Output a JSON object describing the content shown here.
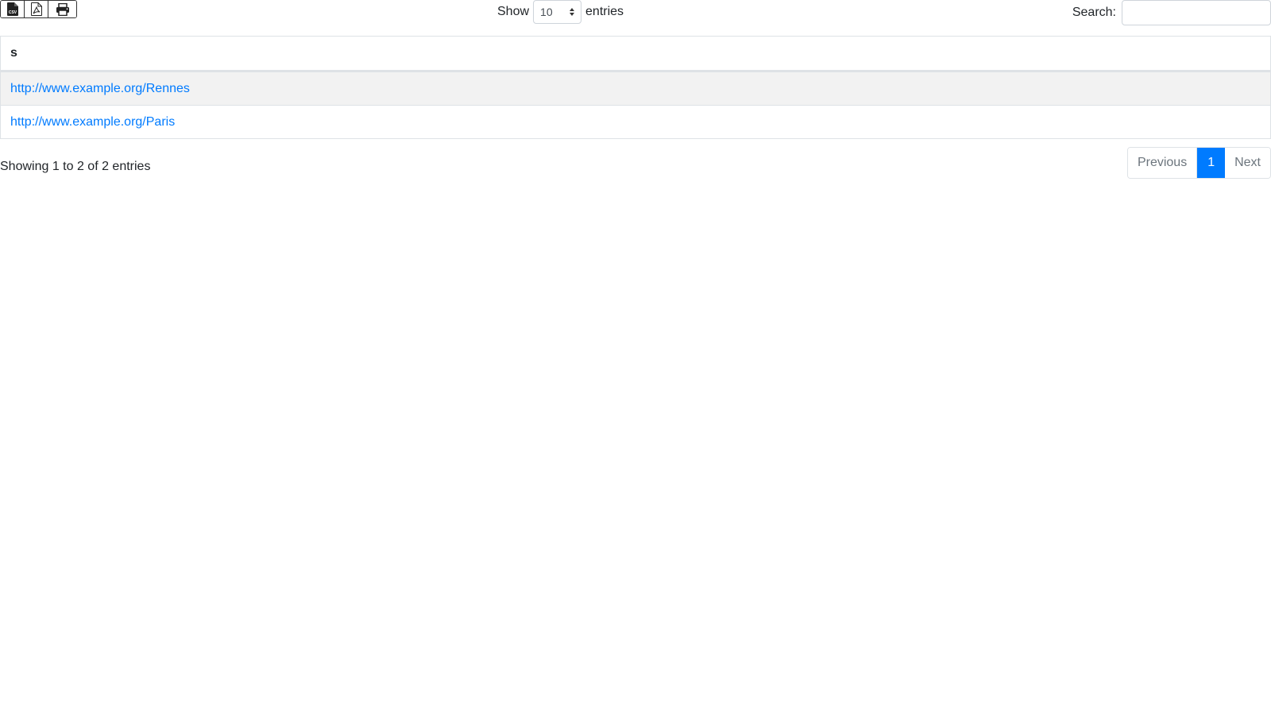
{
  "toolbar": {
    "buttons": [
      {
        "icon": "csv-file-icon"
      },
      {
        "icon": "pdf-file-icon"
      },
      {
        "icon": "print-icon"
      }
    ]
  },
  "length": {
    "show_label": "Show",
    "value": "10",
    "entries_label": "entries"
  },
  "search": {
    "label": "Search:",
    "value": "",
    "placeholder": ""
  },
  "table": {
    "columns": [
      "s"
    ],
    "rows": [
      {
        "s": "http://www.example.org/Rennes"
      },
      {
        "s": "http://www.example.org/Paris"
      }
    ]
  },
  "info": "Showing 1 to 2 of 2 entries",
  "pagination": {
    "previous": "Previous",
    "current": "1",
    "next": "Next"
  },
  "colors": {
    "link": "#007bff",
    "active_page": "#007bff",
    "row_stripe": "#f2f2f2"
  }
}
